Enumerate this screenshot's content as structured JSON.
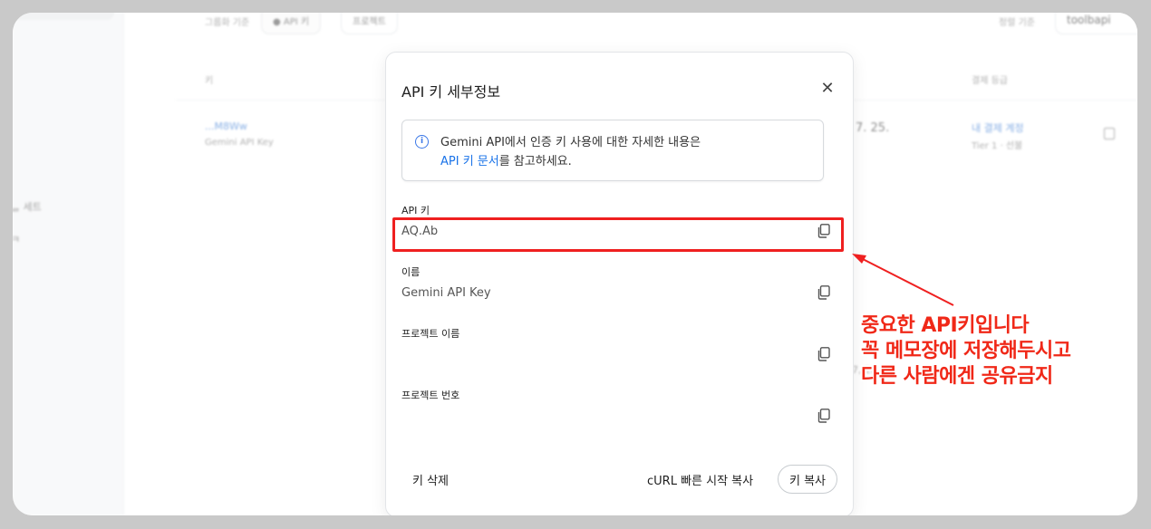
{
  "background": {
    "sidebar_item_1": "ᆯ 세트",
    "sidebar_item_2": "ㅋ",
    "group_by_label": "그룹화 기준",
    "filter_api_key": "● API 키",
    "filter_project": "프로젝트",
    "sort_label": "정렬 기준",
    "search_value": "toolbapi",
    "col_key": "키",
    "col_billing": "결제 등급",
    "row_key_masked": "...M8Ww",
    "row_key_name": "Gemini API Key",
    "row_date": "7. 25.",
    "row_billing_link": "내 결제 계정",
    "row_tier": "Tier 1 · 선불",
    "row_partial": "7, 2E"
  },
  "modal": {
    "title": "API 키 세부정보",
    "info_line1": "Gemini API에서 인증 키 사용에 대한 자세한 내용은",
    "info_link": "API 키 문서",
    "info_line2_rest": "를 참고하세요.",
    "fields": [
      {
        "label": "API 키",
        "value": "AQ.Ab"
      },
      {
        "label": "이름",
        "value": "Gemini API Key"
      },
      {
        "label": "프로젝트 이름",
        "value": ""
      },
      {
        "label": "프로젝트 번호",
        "value": ""
      }
    ],
    "delete_label": "키 삭제",
    "curl_label": "cURL 빠른 시작 복사",
    "copy_key_label": "키 복사"
  },
  "annotation": {
    "text": "중요한 API키입니다\n꼭 메모장에 저장해두시고\n다른 사람에겐 공유금지",
    "color": "#f02818"
  }
}
